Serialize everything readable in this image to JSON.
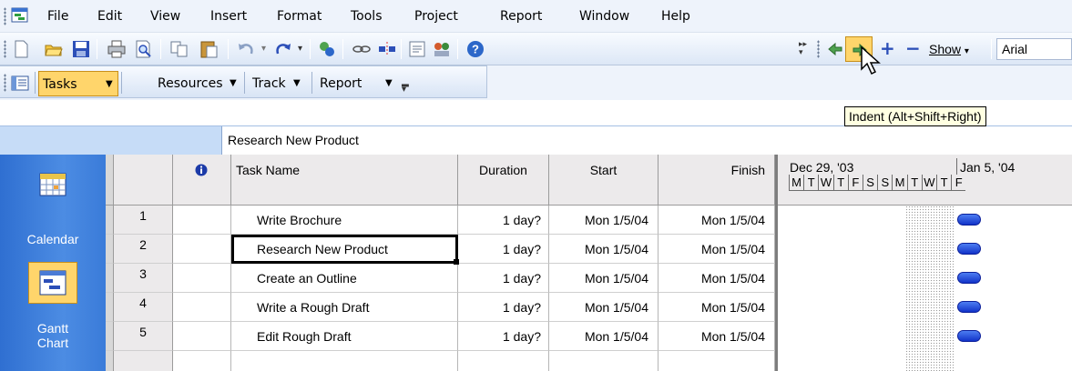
{
  "menubar": {
    "items": [
      "File",
      "Edit",
      "View",
      "Insert",
      "Format",
      "Tools",
      "Project",
      "Report",
      "Window",
      "Help"
    ]
  },
  "toolbar": {
    "icons": [
      "new-icon",
      "open-icon",
      "save-icon",
      "print-icon",
      "print-preview-icon",
      "copy-icon",
      "paste-icon",
      "undo-icon",
      "redo-icon",
      "link-tasks-icon",
      "hyperlink-icon",
      "split-task-icon",
      "task-notes-icon",
      "assign-resources-icon",
      "help-icon"
    ],
    "outline_icons": [
      "outdent-icon",
      "indent-icon",
      "show-subtasks-icon",
      "hide-subtasks-icon"
    ],
    "show_label": "Show",
    "font_value": "Arial"
  },
  "viewbar": {
    "tasks_label": "Tasks",
    "resources_label": "Resources",
    "track_label": "Track",
    "report_label": "Report"
  },
  "tooltip": "Indent (Alt+Shift+Right)",
  "entry_value": "Research New Product",
  "views": {
    "calendar_label": "Calendar",
    "gantt_label_1": "Gantt",
    "gantt_label_2": "Chart"
  },
  "table": {
    "columns": {
      "info": "info-icon",
      "task_name": "Task Name",
      "duration": "Duration",
      "start": "Start",
      "finish": "Finish"
    },
    "rows": [
      {
        "id": "1",
        "name": "Write Brochure",
        "duration": "1 day?",
        "start": "Mon 1/5/04",
        "finish": "Mon 1/5/04"
      },
      {
        "id": "2",
        "name": "Research New Product",
        "duration": "1 day?",
        "start": "Mon 1/5/04",
        "finish": "Mon 1/5/04"
      },
      {
        "id": "3",
        "name": "Create an Outline",
        "duration": "1 day?",
        "start": "Mon 1/5/04",
        "finish": "Mon 1/5/04"
      },
      {
        "id": "4",
        "name": "Write a Rough Draft",
        "duration": "1 day?",
        "start": "Mon 1/5/04",
        "finish": "Mon 1/5/04"
      },
      {
        "id": "5",
        "name": "Edit Rough Draft",
        "duration": "1 day?",
        "start": "Mon 1/5/04",
        "finish": "Mon 1/5/04"
      }
    ]
  },
  "timescale": {
    "week1": "Dec 29, '03",
    "week2": "Jan 5, '04",
    "days": [
      "M",
      "T",
      "W",
      "T",
      "F",
      "S",
      "S",
      "M",
      "T",
      "W",
      "T",
      "F"
    ]
  },
  "colors": {
    "menu_bg": "#eef3fb",
    "entry_bar": "#c6dcf7",
    "view_bar": "#3a7bd9",
    "gantt_bar": "#2a4fdc",
    "tooltip_bg": "#ffffe1",
    "highlight": "#ffd56b"
  }
}
